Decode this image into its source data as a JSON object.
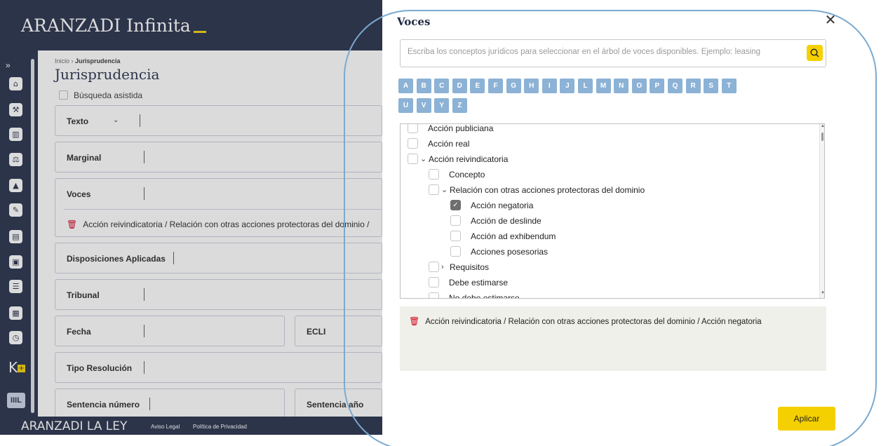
{
  "app": {
    "brand": "ARANZADI Infinita",
    "breadcrumb_home": "Inicio",
    "breadcrumb_sep": "›",
    "breadcrumb_current": "Jurisprudencia",
    "page_title": "Jurisprudencia",
    "assisted_search": "Búsqueda asistida",
    "rail_expand": "»",
    "rail_icons": [
      "home-icon",
      "gavel-icon",
      "bank-icon",
      "scales-icon",
      "graduation-icon",
      "edit-icon",
      "document-icon",
      "form-icon",
      "list-icon",
      "calculator-icon",
      "clock-icon"
    ],
    "fields": {
      "texto": "Texto",
      "marginal": "Marginal",
      "voces": "Voces",
      "voces_selected": "Acción reivindicatoria / Relación con otras acciones protectoras del dominio /",
      "disposiciones": "Disposiciones Aplicadas",
      "tribunal": "Tribunal",
      "fecha": "Fecha",
      "ecli": "ECLI",
      "tipo_resolucion": "Tipo Resolución",
      "sentencia_numero": "Sentencia número",
      "sentencia_anio": "Sentencia año"
    },
    "footer": {
      "brand": "ARANZADI LA LEY",
      "aviso_legal": "Aviso Legal",
      "privacidad": "Política de Privacidad"
    }
  },
  "modal": {
    "title": "Voces",
    "close": "✕",
    "search_placeholder": "Escriba los conceptos jurídicos para seleccionar en el árbol de voces disponibles. Ejemplo: leasing",
    "letters": [
      "A",
      "B",
      "C",
      "D",
      "E",
      "F",
      "G",
      "H",
      "I",
      "J",
      "L",
      "M",
      "N",
      "O",
      "P",
      "Q",
      "R",
      "S",
      "T",
      "U",
      "V",
      "Y",
      "Z"
    ],
    "tree": [
      {
        "label": "Acción publiciana",
        "level": 0,
        "checked": false,
        "caret": ""
      },
      {
        "label": "Acción real",
        "level": 0,
        "checked": false,
        "caret": ""
      },
      {
        "label": "Acción reivindicatoria",
        "level": 0,
        "checked": false,
        "caret": "v"
      },
      {
        "label": "Concepto",
        "level": 1,
        "checked": false,
        "caret": ""
      },
      {
        "label": "Relación con otras acciones protectoras del dominio",
        "level": 1,
        "checked": false,
        "caret": "v"
      },
      {
        "label": "Acción negatoria",
        "level": 2,
        "checked": true,
        "caret": ""
      },
      {
        "label": "Acción de deslinde",
        "level": 2,
        "checked": false,
        "caret": ""
      },
      {
        "label": "Acción ad exhibendum",
        "level": 2,
        "checked": false,
        "caret": ""
      },
      {
        "label": "Acciones posesorias",
        "level": 2,
        "checked": false,
        "caret": ""
      },
      {
        "label": "Requisitos",
        "level": 1,
        "checked": false,
        "caret": ">"
      },
      {
        "label": "Debe estimarse",
        "level": 1,
        "checked": false,
        "caret": ""
      },
      {
        "label": "No debe estimarse",
        "level": 1,
        "checked": false,
        "caret": ""
      }
    ],
    "selected_item": "Acción reivindicatoria / Relación con otras acciones protectoras del dominio / Acción negatoria",
    "apply": "Aplicar"
  },
  "colors": {
    "navy": "#1f2a44",
    "accent_yellow": "#f5d000",
    "letter_blue": "#8cb2d6",
    "trash_red": "#d0021b"
  }
}
